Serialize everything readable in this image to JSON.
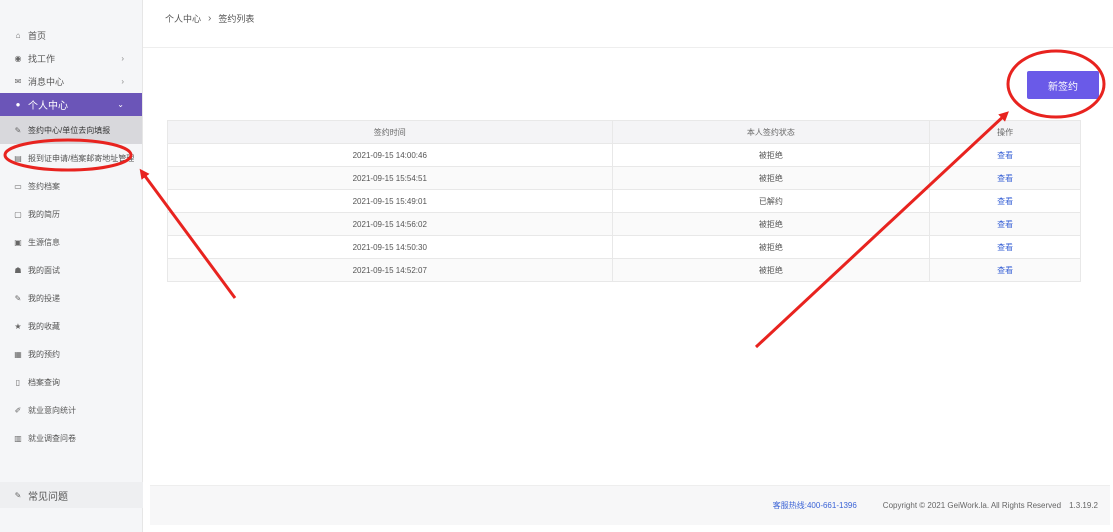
{
  "sidebar": {
    "items": [
      {
        "icon": "home-icon",
        "label": "首页",
        "chevron": ""
      },
      {
        "icon": "eye-icon",
        "label": "找工作",
        "chevron": "›"
      },
      {
        "icon": "message-icon",
        "label": "消息中心",
        "chevron": "›"
      },
      {
        "icon": "user-icon",
        "label": "个人中心",
        "chevron": "⌄"
      },
      {
        "icon": "edit-icon",
        "label": "签约中心/单位去向填报"
      },
      {
        "icon": "card-icon",
        "label": "报到证申请/档案邮寄地址管理"
      },
      {
        "icon": "doc-icon",
        "label": "签约档案"
      },
      {
        "icon": "resume-icon",
        "label": "我的简历"
      },
      {
        "icon": "id-icon",
        "label": "生源信息"
      },
      {
        "icon": "interview-icon",
        "label": "我的面试"
      },
      {
        "icon": "edit-icon",
        "label": "我的投递"
      },
      {
        "icon": "star-icon",
        "label": "我的收藏"
      },
      {
        "icon": "calendar-icon",
        "label": "我的预约"
      },
      {
        "icon": "file-icon",
        "label": "档案查询"
      },
      {
        "icon": "pen-icon",
        "label": "就业意向统计"
      },
      {
        "icon": "survey-icon",
        "label": "就业调查问卷"
      }
    ],
    "bottom": {
      "icon": "question-icon",
      "label": "常见问题"
    }
  },
  "breadcrumb": {
    "parent": "个人中心",
    "separator": "›",
    "current": "签约列表"
  },
  "new_button": {
    "label": "新签约"
  },
  "table": {
    "headers": [
      "签约时间",
      "本人签约状态",
      "操作"
    ],
    "rows": [
      {
        "time": "2021-09-15 14:00:46",
        "status": "被拒绝",
        "action": "查看"
      },
      {
        "time": "2021-09-15 15:54:51",
        "status": "被拒绝",
        "action": "查看"
      },
      {
        "time": "2021-09-15 15:49:01",
        "status": "已解约",
        "action": "查看"
      },
      {
        "time": "2021-09-15 14:56:02",
        "status": "被拒绝",
        "action": "查看"
      },
      {
        "time": "2021-09-15 14:50:30",
        "status": "被拒绝",
        "action": "查看"
      },
      {
        "time": "2021-09-15 14:52:07",
        "status": "被拒绝",
        "action": "查看"
      }
    ]
  },
  "footer": {
    "hotline_label": "客服热线:",
    "hotline_number": "400-661-1396",
    "copyright": "Copyright © 2021 GeiWork.la. All Rights Reserved",
    "version": "1.3.19.2"
  },
  "colors": {
    "accent": "#6b55b8",
    "button": "#6a5ae8",
    "link": "#3a63d6",
    "annotation": "#e8231f"
  }
}
